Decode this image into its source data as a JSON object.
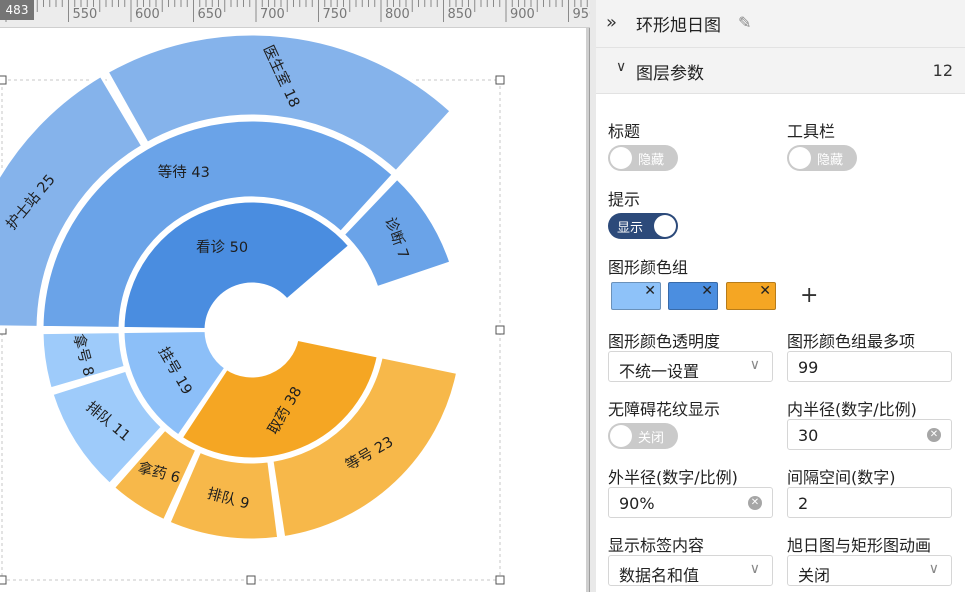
{
  "ruler": {
    "corner_value": "483",
    "ticks": [
      "550",
      "600",
      "650",
      "700",
      "750",
      "800",
      "850",
      "900",
      "950"
    ]
  },
  "panel": {
    "title": "环形旭日图"
  },
  "section": {
    "title": "图层参数",
    "count": "12"
  },
  "settings": {
    "title_label": "标题",
    "title_toggle": "隐藏",
    "toolbar_label": "工具栏",
    "toolbar_toggle": "隐藏",
    "tooltip_label": "提示",
    "tooltip_toggle": "显示",
    "palette_label": "图形颜色组",
    "palette": [
      "#8ec2f9",
      "#4b8ee0",
      "#f5a623"
    ],
    "opacity_label": "图形颜色透明度",
    "opacity_value": "不统一设置",
    "max_colors_label": "图形颜色组最多项",
    "max_colors_value": "99",
    "pattern_label": "无障碍花纹显示",
    "pattern_toggle": "关闭",
    "inner_radius_label": "内半径(数字/比例)",
    "inner_radius_value": "30",
    "outer_radius_label": "外半径(数字/比例)",
    "outer_radius_value": "90%",
    "gap_label": "间隔空间(数字)",
    "gap_value": "2",
    "label_content_label": "显示标签内容",
    "label_content_value": "数据名和值",
    "animation_label": "旭日图与矩形图动画",
    "animation_value": "关闭"
  },
  "chart_data": {
    "type": "sunburst",
    "colors": {
      "blue_root": "#4a8de0",
      "blue_mid": "#6aa3e8",
      "blue_leaf": "#85b3eb",
      "light_leaf": "#9ecbfa",
      "light_mid": "#8cbff8",
      "orange_root": "#f5a623",
      "orange_leaf": "#f7b84a"
    },
    "data": [
      {
        "name": "看诊",
        "value": 50,
        "children": [
          {
            "name": "等待",
            "value": 43,
            "children": [
              {
                "name": "护士站",
                "value": 25
              },
              {
                "name": "医生室",
                "value": 18
              }
            ]
          },
          {
            "name": "诊断",
            "value": 7
          }
        ]
      },
      {
        "name": "取药",
        "value": 38,
        "children": [
          {
            "name": "等号",
            "value": 23
          },
          {
            "name": "排队",
            "value": 9
          },
          {
            "name": "拿药",
            "value": 6
          }
        ]
      },
      {
        "name": "挂号",
        "value": 19,
        "children": [
          {
            "name": "排队",
            "value": 11
          },
          {
            "name": "拿号",
            "value": 8
          }
        ]
      }
    ]
  }
}
